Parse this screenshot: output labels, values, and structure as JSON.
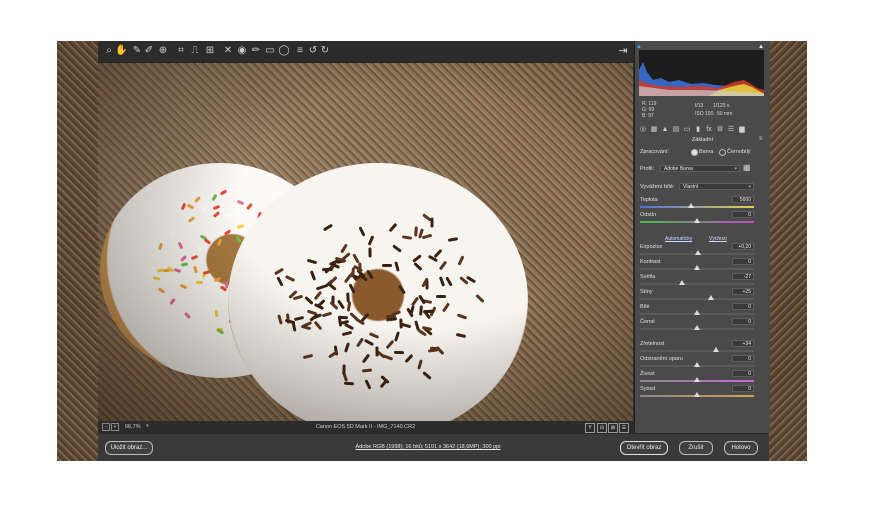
{
  "toolbar": {
    "tools": [
      "zoom-icon",
      "hand-icon",
      "white-balance-icon",
      "color-sampler-icon",
      "targeted-adjust-icon",
      "crop-icon",
      "straighten-icon",
      "transform-icon",
      "spot-removal-icon",
      "red-eye-icon",
      "adjustment-brush-icon",
      "graduated-filter-icon",
      "radial-filter-icon",
      "preferences-icon",
      "rotate-left-icon",
      "rotate-right-icon"
    ],
    "tool_glyphs": [
      "⌕",
      "✋",
      "✎",
      "✐",
      "⊕",
      "⌗",
      "⎍",
      "⊞",
      "✕",
      "◉",
      "✏",
      "▭",
      "◯",
      "≡",
      "↺",
      "↻"
    ],
    "export_glyph": "⇥"
  },
  "status": {
    "zoom_minus": "−",
    "zoom_plus": "+",
    "zoom": "66,7%",
    "zoom_arrow": "▾",
    "file_info": "Canon EOS 5D Mark II  -  IMG_7140.CR2",
    "view_buttons": [
      "Y",
      "⊟",
      "⊠",
      "☰"
    ]
  },
  "histogram": {
    "rgb": {
      "r": "R:   119",
      "g": "G:   99",
      "b": "B:   97"
    },
    "aperture": "f/13",
    "shutter": "1/125 s",
    "iso": "ISO 100",
    "focal": "50 mm"
  },
  "panel_tab_glyphs": [
    "◎",
    "▦",
    "▲",
    "▤",
    "▭",
    "▮",
    "fx",
    "⚙",
    "☰",
    "▆"
  ],
  "basic": {
    "section_title": "Základní",
    "menu_icon": "≡",
    "processing_label": "Zpracování:",
    "processing_options": [
      "Barva",
      "Černobílý"
    ],
    "profile_label": "Profil:",
    "profile_value": "Adobe Barva",
    "wb_label": "Vyvážení bílé:",
    "wb_value": "Vlastní",
    "auto_link": "Automaticky",
    "default_link": "Výchozí"
  },
  "sliders": [
    {
      "label": "Teplota",
      "value": "5000",
      "level": 0.45
    },
    {
      "label": "Odstín",
      "value": "0",
      "level": 0.5
    },
    {
      "label": "Expozice",
      "value": "+0,20",
      "level": 0.51
    },
    {
      "label": "Kontrast",
      "value": "0",
      "level": 0.5
    },
    {
      "label": "Světla",
      "value": "-27",
      "level": 0.37
    },
    {
      "label": "Stíny",
      "value": "+25",
      "level": 0.62
    },
    {
      "label": "Bílé",
      "value": "0",
      "level": 0.5
    },
    {
      "label": "Černé",
      "value": "0",
      "level": 0.5
    },
    {
      "label": "Zřetelnost",
      "value": "+34",
      "level": 0.67
    },
    {
      "label": "Odstranění oparu",
      "value": "0",
      "level": 0.5
    },
    {
      "label": "Živost",
      "value": "0",
      "level": 0.5
    },
    {
      "label": "Sytost",
      "value": "0",
      "level": 0.5
    }
  ],
  "bottom": {
    "save_label": "Uložit obraz...",
    "workflow": "Adobe RGB (1998); 16 bitů; 5101 x 3642 (18,6MP); 300 ppi",
    "open_label": "Otevřít obraz",
    "cancel_label": "Zrušit",
    "done_label": "Hotovo"
  },
  "colors": {
    "panel_bg": "#4a4a4a",
    "toolbar_bg": "#2c2c2c",
    "histogram_blue": "#3b6fd6",
    "histogram_red": "#d53a2a",
    "histogram_yellow": "#e2d23a"
  }
}
